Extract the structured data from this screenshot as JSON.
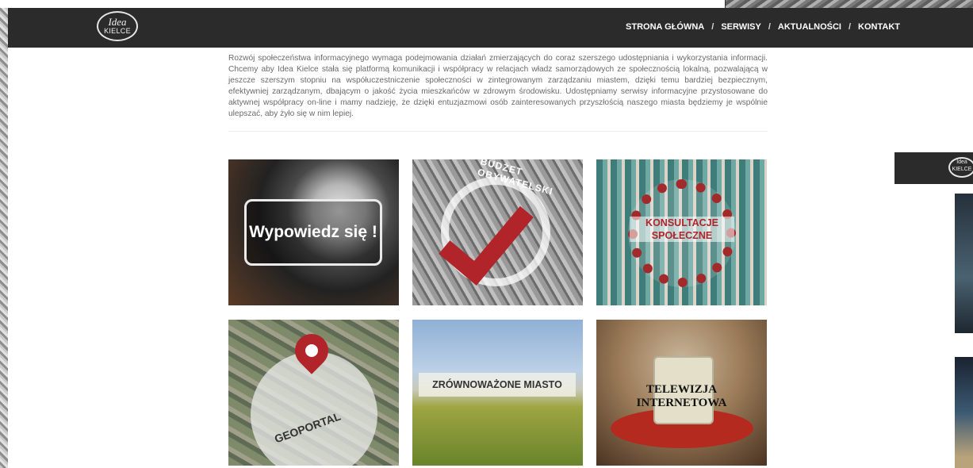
{
  "logo": {
    "line1": "Idea",
    "line2": "KIELCE"
  },
  "nav": {
    "items": [
      "STRONA GŁÓWNA",
      "SERWISY",
      "AKTUALNOŚCI",
      "KONTAKT"
    ],
    "separator": "/"
  },
  "intro": "Rozwój społeczeństwa informacyjnego wymaga podejmowania działań zmierzających do coraz szerszego udostępniania i wykorzystania informacji. Chcemy aby Idea Kielce stała się platformą komunikacji i współpracy w relacjach władz samorządowych ze społecznością lokalną, pozwalającą w jeszcze szerszym stopniu na współuczestniczenie społeczności w zintegrowanym zarządzaniu miastem, dzięki temu bardziej bezpiecznym, efektywniej zarządzanym, dbającym o jakość życia mieszkańców w zdrowym środowisku. Udostępniamy serwisy informacyjne przystosowane do aktywnej współpracy on-line i mamy nadzieję, że dzięki entuzjazmowi osób zainteresowanych przyszłością naszego miasta będziemy je wspólnie ulepszać, aby żyło się w nim lepiej.",
  "tiles": [
    {
      "label": "Wypowiedz się !"
    },
    {
      "label": "BUDŻET OBYWATELSKI"
    },
    {
      "label": "KONSULTACJE SPOŁECZNE"
    },
    {
      "label": "GEOPORTAL"
    },
    {
      "label": "ZRÓWNOWAŻONE MIASTO"
    },
    {
      "label": "TELEWIZJA INTERNETOWA"
    }
  ],
  "second_window": {
    "logo": "Idea KIELCE"
  },
  "colors": {
    "navbar": "#2b2b2b",
    "accent_red": "#b0242a",
    "text": "#6a6a6a"
  }
}
